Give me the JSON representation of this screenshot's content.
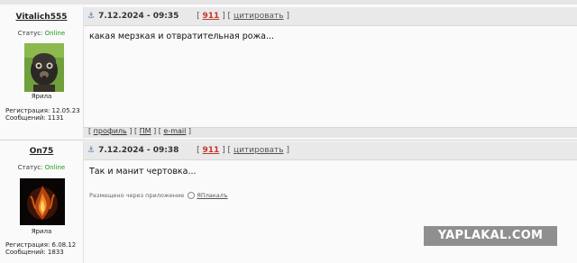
{
  "posts": [
    {
      "username": "Vitalich555",
      "status_label": "Статус:",
      "status_value": "Online",
      "group": "Ярила",
      "registration": "Регистрация: 12.05.23",
      "messages": "Сообщений: 1131",
      "date": "7.12.2024 - 09:35",
      "post_number": "911",
      "quote_label": "цитировать",
      "text": "какая мерзкая и отвратительная рожа...",
      "profile_label": "профиль",
      "pm_label": "ПМ",
      "email_label": "e-mail"
    },
    {
      "username": "On75",
      "status_label": "Статус:",
      "status_value": "Online",
      "group": "Ярила",
      "registration": "Регистрация: 6.08.12",
      "messages": "Сообщений: 1833",
      "date": "7.12.2024 - 09:38",
      "post_number": "911",
      "quote_label": "цитировать",
      "text": "Так и манит чертовка...",
      "posted_via": "Размещено через приложение",
      "app_name": "ЯПлакалъ"
    }
  ],
  "watermark": "YAPLAKAL.COM",
  "colors": {
    "online": "#1f9a1f",
    "post_number": "#c0392b",
    "anchor_icon": "#4e7bb0"
  },
  "icons": {
    "post_anchor": "anchor-icon",
    "app_logo": "app-circle-icon"
  }
}
